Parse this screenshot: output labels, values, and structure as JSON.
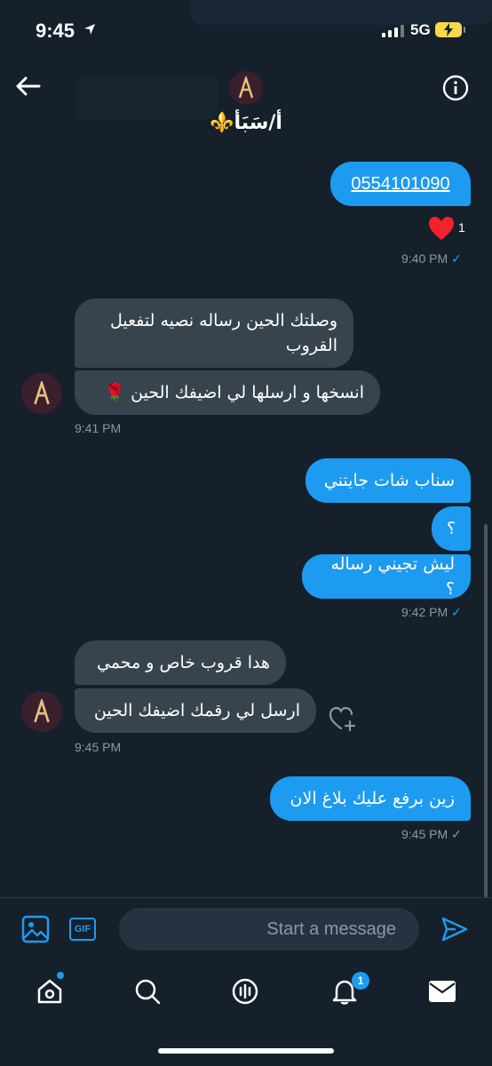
{
  "status_bar": {
    "time": "9:45",
    "network": "5G"
  },
  "header": {
    "contact_name": "أ/سَبَأ⚜️"
  },
  "messages": [
    {
      "type": "sent",
      "text": "0554101090",
      "reaction_count": "1",
      "time": "9:40 PM"
    },
    {
      "type": "received",
      "text": "وصلتك الحين رساله نصيه لتفعيل القروب"
    },
    {
      "type": "received",
      "text": "انسخها و ارسلها لي اضيفك الحين 🌹",
      "time": "9:41 PM"
    },
    {
      "type": "sent",
      "text": "سناب شات جايتني"
    },
    {
      "type": "sent",
      "text": "؟"
    },
    {
      "type": "sent",
      "text": "ليش تجيني رساله ؟",
      "time": "9:42 PM"
    },
    {
      "type": "received",
      "text": "هدا قروب خاص و محمي"
    },
    {
      "type": "received",
      "text": "ارسل لي رقمك اضيفك الحين",
      "time": "9:45 PM"
    },
    {
      "type": "sent",
      "text": "زين برفع عليك بلاغ الان",
      "time": "9:45 PM"
    }
  ],
  "composer": {
    "placeholder": "Start a message",
    "gif_label": "GIF"
  },
  "tabbar": {
    "notifications_badge": "1"
  },
  "colors": {
    "background": "#15202b",
    "accent": "#1d9bf0",
    "received_bubble": "#38444d"
  }
}
